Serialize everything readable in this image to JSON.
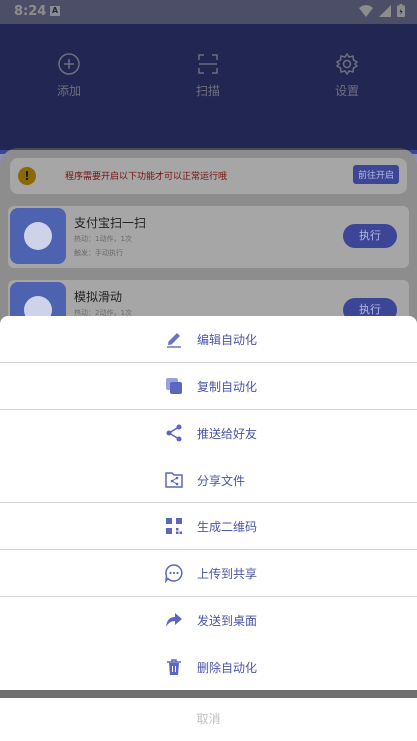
{
  "status_bar": {
    "time": "8:24",
    "notification_icon": "A"
  },
  "actions": [
    {
      "label": "添加",
      "icon": "plus-circle-icon"
    },
    {
      "label": "扫描",
      "icon": "scan-icon"
    },
    {
      "label": "设置",
      "icon": "gear-icon"
    }
  ],
  "notice": {
    "message": "程序需要开启以下功能才可以正常运行哦",
    "button": "前往开启"
  },
  "cards": [
    {
      "title": "支付宝扫一扫",
      "sub1": "热动：1动作，1次",
      "sub2": "触发：手动执行",
      "run": "执行"
    },
    {
      "title": "模拟滑动",
      "sub1": "热动：2动作，1次",
      "run": "执行"
    }
  ],
  "menu": [
    {
      "label": "编辑自动化",
      "icon": "edit-icon"
    },
    {
      "label": "复制自动化",
      "icon": "copy-icon"
    },
    {
      "label": "推送给好友",
      "icon": "share-icon"
    },
    {
      "label": "分享文件",
      "icon": "share-file-icon"
    },
    {
      "label": "生成二维码",
      "icon": "qr-code-icon"
    },
    {
      "label": "上传到共享",
      "icon": "upload-chat-icon"
    },
    {
      "label": "发送到桌面",
      "icon": "send-to-desktop-icon"
    },
    {
      "label": "删除自动化",
      "icon": "delete-icon"
    }
  ],
  "cancel": "取消",
  "colors": {
    "accent": "#4a55a8",
    "topbar": "#3d4596"
  }
}
